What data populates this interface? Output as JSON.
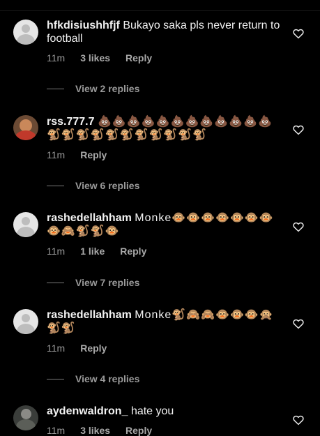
{
  "comments": [
    {
      "username": "hfkdisiushhfjf",
      "text": "Bukayo saka pls never return to football",
      "time": "11m",
      "likes": "3 likes",
      "reply_label": "Reply",
      "view_replies": "View 2 replies"
    },
    {
      "username": "rss.777.7",
      "text": "💩💩💩💩💩💩💩💩💩💩💩💩🐒🐒🐒🐒🐒🐒🐒🐒🐒🐒🐒",
      "time": "11m",
      "reply_label": "Reply",
      "view_replies": "View 6 replies"
    },
    {
      "username": "rashedellahham",
      "text": "Monke🐵🐵🐵🐵🐵🐵🐵🐵🙈🐒🐒🐵",
      "time": "11m",
      "likes": "1 like",
      "reply_label": "Reply",
      "view_replies": "View 7 replies"
    },
    {
      "username": "rashedellahham",
      "text": "Monke🐒🙈🙈🐵🐵🐵🙊🐒🐒",
      "time": "11m",
      "reply_label": "Reply",
      "view_replies": "View 4 replies"
    },
    {
      "username": "aydenwaldron_",
      "text": "hate you",
      "time": "11m",
      "likes": "3 likes",
      "reply_label": "Reply"
    }
  ]
}
